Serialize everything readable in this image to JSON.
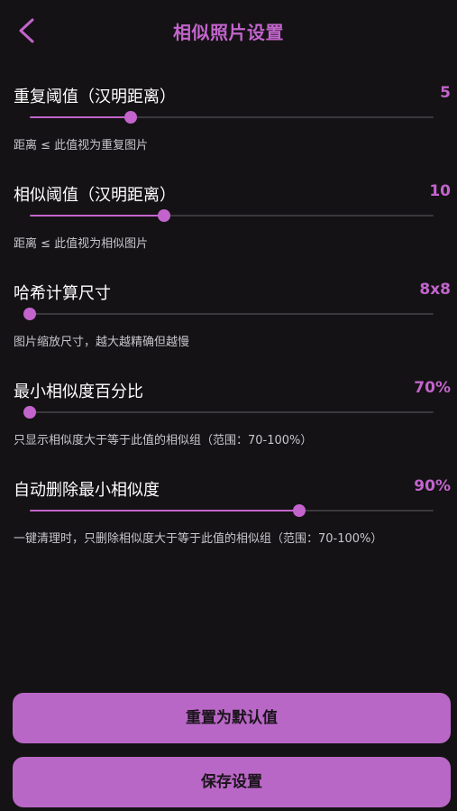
{
  "header": {
    "title": "相似照片设置"
  },
  "settings": [
    {
      "label": "重复阈值（汉明距离）",
      "value": "5",
      "fraction": 0.25,
      "description": "距离 ≤ 此值视为重复图片"
    },
    {
      "label": "相似阈值（汉明距离）",
      "value": "10",
      "fraction": 0.333,
      "description": "距离 ≤ 此值视为相似图片"
    },
    {
      "label": "哈希计算尺寸",
      "value": "8x8",
      "fraction": 0,
      "description": "图片缩放尺寸，越大越精确但越慢"
    },
    {
      "label": "最小相似度百分比",
      "value": "70%",
      "fraction": 0,
      "description": "只显示相似度大于等于此值的相似组（范围：70-100%）"
    },
    {
      "label": "自动删除最小相似度",
      "value": "90%",
      "fraction": 0.667,
      "description": "一键清理时，只删除相似度大于等于此值的相似组（范围：70-100%）"
    }
  ],
  "buttons": {
    "reset_label": "重置为默认值",
    "save_label": "保存设置"
  },
  "colors": {
    "background": "#141214",
    "accent": "#c264cc",
    "button": "#b967c6",
    "track": "#3a383c"
  }
}
